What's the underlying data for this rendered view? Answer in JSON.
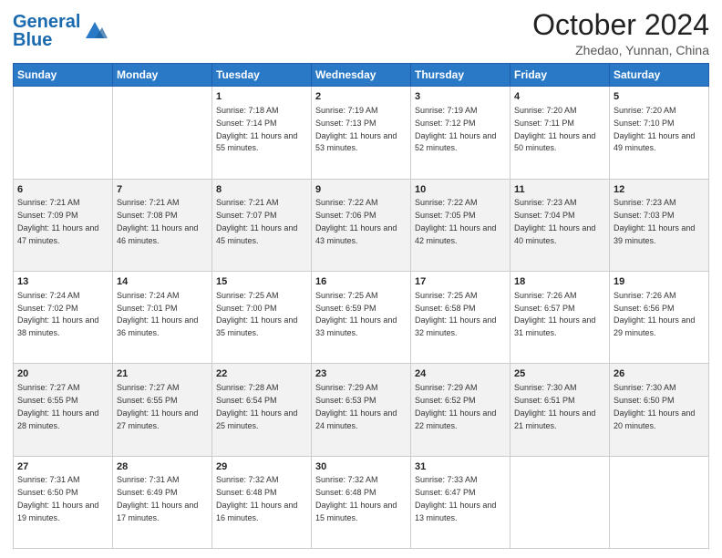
{
  "header": {
    "logo_general": "General",
    "logo_blue": "Blue",
    "title": "October 2024",
    "subtitle": "Zhedao, Yunnan, China"
  },
  "days": [
    "Sunday",
    "Monday",
    "Tuesday",
    "Wednesday",
    "Thursday",
    "Friday",
    "Saturday"
  ],
  "weeks": [
    [
      {
        "day": "",
        "sunrise": "",
        "sunset": "",
        "daylight": ""
      },
      {
        "day": "",
        "sunrise": "",
        "sunset": "",
        "daylight": ""
      },
      {
        "day": "1",
        "sunrise": "Sunrise: 7:18 AM",
        "sunset": "Sunset: 7:14 PM",
        "daylight": "Daylight: 11 hours and 55 minutes."
      },
      {
        "day": "2",
        "sunrise": "Sunrise: 7:19 AM",
        "sunset": "Sunset: 7:13 PM",
        "daylight": "Daylight: 11 hours and 53 minutes."
      },
      {
        "day": "3",
        "sunrise": "Sunrise: 7:19 AM",
        "sunset": "Sunset: 7:12 PM",
        "daylight": "Daylight: 11 hours and 52 minutes."
      },
      {
        "day": "4",
        "sunrise": "Sunrise: 7:20 AM",
        "sunset": "Sunset: 7:11 PM",
        "daylight": "Daylight: 11 hours and 50 minutes."
      },
      {
        "day": "5",
        "sunrise": "Sunrise: 7:20 AM",
        "sunset": "Sunset: 7:10 PM",
        "daylight": "Daylight: 11 hours and 49 minutes."
      }
    ],
    [
      {
        "day": "6",
        "sunrise": "Sunrise: 7:21 AM",
        "sunset": "Sunset: 7:09 PM",
        "daylight": "Daylight: 11 hours and 47 minutes."
      },
      {
        "day": "7",
        "sunrise": "Sunrise: 7:21 AM",
        "sunset": "Sunset: 7:08 PM",
        "daylight": "Daylight: 11 hours and 46 minutes."
      },
      {
        "day": "8",
        "sunrise": "Sunrise: 7:21 AM",
        "sunset": "Sunset: 7:07 PM",
        "daylight": "Daylight: 11 hours and 45 minutes."
      },
      {
        "day": "9",
        "sunrise": "Sunrise: 7:22 AM",
        "sunset": "Sunset: 7:06 PM",
        "daylight": "Daylight: 11 hours and 43 minutes."
      },
      {
        "day": "10",
        "sunrise": "Sunrise: 7:22 AM",
        "sunset": "Sunset: 7:05 PM",
        "daylight": "Daylight: 11 hours and 42 minutes."
      },
      {
        "day": "11",
        "sunrise": "Sunrise: 7:23 AM",
        "sunset": "Sunset: 7:04 PM",
        "daylight": "Daylight: 11 hours and 40 minutes."
      },
      {
        "day": "12",
        "sunrise": "Sunrise: 7:23 AM",
        "sunset": "Sunset: 7:03 PM",
        "daylight": "Daylight: 11 hours and 39 minutes."
      }
    ],
    [
      {
        "day": "13",
        "sunrise": "Sunrise: 7:24 AM",
        "sunset": "Sunset: 7:02 PM",
        "daylight": "Daylight: 11 hours and 38 minutes."
      },
      {
        "day": "14",
        "sunrise": "Sunrise: 7:24 AM",
        "sunset": "Sunset: 7:01 PM",
        "daylight": "Daylight: 11 hours and 36 minutes."
      },
      {
        "day": "15",
        "sunrise": "Sunrise: 7:25 AM",
        "sunset": "Sunset: 7:00 PM",
        "daylight": "Daylight: 11 hours and 35 minutes."
      },
      {
        "day": "16",
        "sunrise": "Sunrise: 7:25 AM",
        "sunset": "Sunset: 6:59 PM",
        "daylight": "Daylight: 11 hours and 33 minutes."
      },
      {
        "day": "17",
        "sunrise": "Sunrise: 7:25 AM",
        "sunset": "Sunset: 6:58 PM",
        "daylight": "Daylight: 11 hours and 32 minutes."
      },
      {
        "day": "18",
        "sunrise": "Sunrise: 7:26 AM",
        "sunset": "Sunset: 6:57 PM",
        "daylight": "Daylight: 11 hours and 31 minutes."
      },
      {
        "day": "19",
        "sunrise": "Sunrise: 7:26 AM",
        "sunset": "Sunset: 6:56 PM",
        "daylight": "Daylight: 11 hours and 29 minutes."
      }
    ],
    [
      {
        "day": "20",
        "sunrise": "Sunrise: 7:27 AM",
        "sunset": "Sunset: 6:55 PM",
        "daylight": "Daylight: 11 hours and 28 minutes."
      },
      {
        "day": "21",
        "sunrise": "Sunrise: 7:27 AM",
        "sunset": "Sunset: 6:55 PM",
        "daylight": "Daylight: 11 hours and 27 minutes."
      },
      {
        "day": "22",
        "sunrise": "Sunrise: 7:28 AM",
        "sunset": "Sunset: 6:54 PM",
        "daylight": "Daylight: 11 hours and 25 minutes."
      },
      {
        "day": "23",
        "sunrise": "Sunrise: 7:29 AM",
        "sunset": "Sunset: 6:53 PM",
        "daylight": "Daylight: 11 hours and 24 minutes."
      },
      {
        "day": "24",
        "sunrise": "Sunrise: 7:29 AM",
        "sunset": "Sunset: 6:52 PM",
        "daylight": "Daylight: 11 hours and 22 minutes."
      },
      {
        "day": "25",
        "sunrise": "Sunrise: 7:30 AM",
        "sunset": "Sunset: 6:51 PM",
        "daylight": "Daylight: 11 hours and 21 minutes."
      },
      {
        "day": "26",
        "sunrise": "Sunrise: 7:30 AM",
        "sunset": "Sunset: 6:50 PM",
        "daylight": "Daylight: 11 hours and 20 minutes."
      }
    ],
    [
      {
        "day": "27",
        "sunrise": "Sunrise: 7:31 AM",
        "sunset": "Sunset: 6:50 PM",
        "daylight": "Daylight: 11 hours and 19 minutes."
      },
      {
        "day": "28",
        "sunrise": "Sunrise: 7:31 AM",
        "sunset": "Sunset: 6:49 PM",
        "daylight": "Daylight: 11 hours and 17 minutes."
      },
      {
        "day": "29",
        "sunrise": "Sunrise: 7:32 AM",
        "sunset": "Sunset: 6:48 PM",
        "daylight": "Daylight: 11 hours and 16 minutes."
      },
      {
        "day": "30",
        "sunrise": "Sunrise: 7:32 AM",
        "sunset": "Sunset: 6:48 PM",
        "daylight": "Daylight: 11 hours and 15 minutes."
      },
      {
        "day": "31",
        "sunrise": "Sunrise: 7:33 AM",
        "sunset": "Sunset: 6:47 PM",
        "daylight": "Daylight: 11 hours and 13 minutes."
      },
      {
        "day": "",
        "sunrise": "",
        "sunset": "",
        "daylight": ""
      },
      {
        "day": "",
        "sunrise": "",
        "sunset": "",
        "daylight": ""
      }
    ]
  ]
}
